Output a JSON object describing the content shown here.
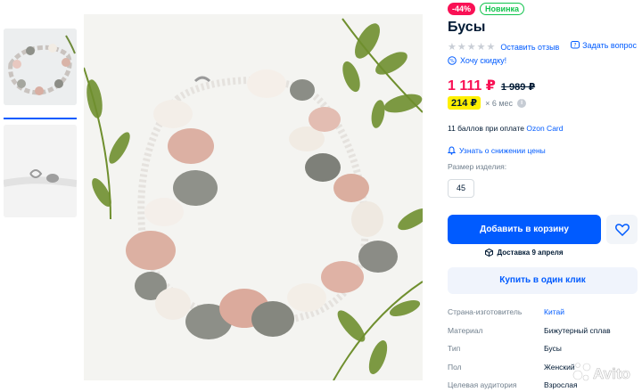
{
  "product": {
    "badges": {
      "discount": "-44%",
      "new": "Новинка"
    },
    "title": "Бусы",
    "review_link": "Оставить отзыв",
    "ask_link": "Задать вопрос",
    "discount_link": "Хочу скидку!",
    "price": "1 111 ₽",
    "old_price": "1 989 ₽",
    "installment_price": "214 ₽",
    "installment_term": "× 6 мес",
    "bonus_text": "11 баллов при оплате ",
    "bonus_card": "Ozon Card",
    "notify_link": "Узнать о снижении цены",
    "size_label": "Размер изделия:",
    "size_value": "45",
    "cart_button": "Добавить в корзину",
    "delivery_text": "Доставка 9 апреля",
    "one_click_button": "Купить в один клик",
    "specs": [
      {
        "key": "Страна-изготовитель",
        "value": "Китай"
      },
      {
        "key": "Материал",
        "value": "Бижутерный сплав"
      },
      {
        "key": "Тип",
        "value": "Бусы"
      },
      {
        "key": "Пол",
        "value": "Женский"
      },
      {
        "key": "Целевая аудитория",
        "value": "Взрослая"
      }
    ]
  },
  "watermark": "Avito",
  "colors": {
    "accent": "#005bff",
    "price": "#f91155",
    "new_badge": "#10c44c",
    "installment": "#fff000"
  },
  "icons": [
    "star-icon",
    "question-icon",
    "percent-chat-icon",
    "info-icon",
    "bell-icon",
    "heart-icon",
    "box-icon"
  ]
}
